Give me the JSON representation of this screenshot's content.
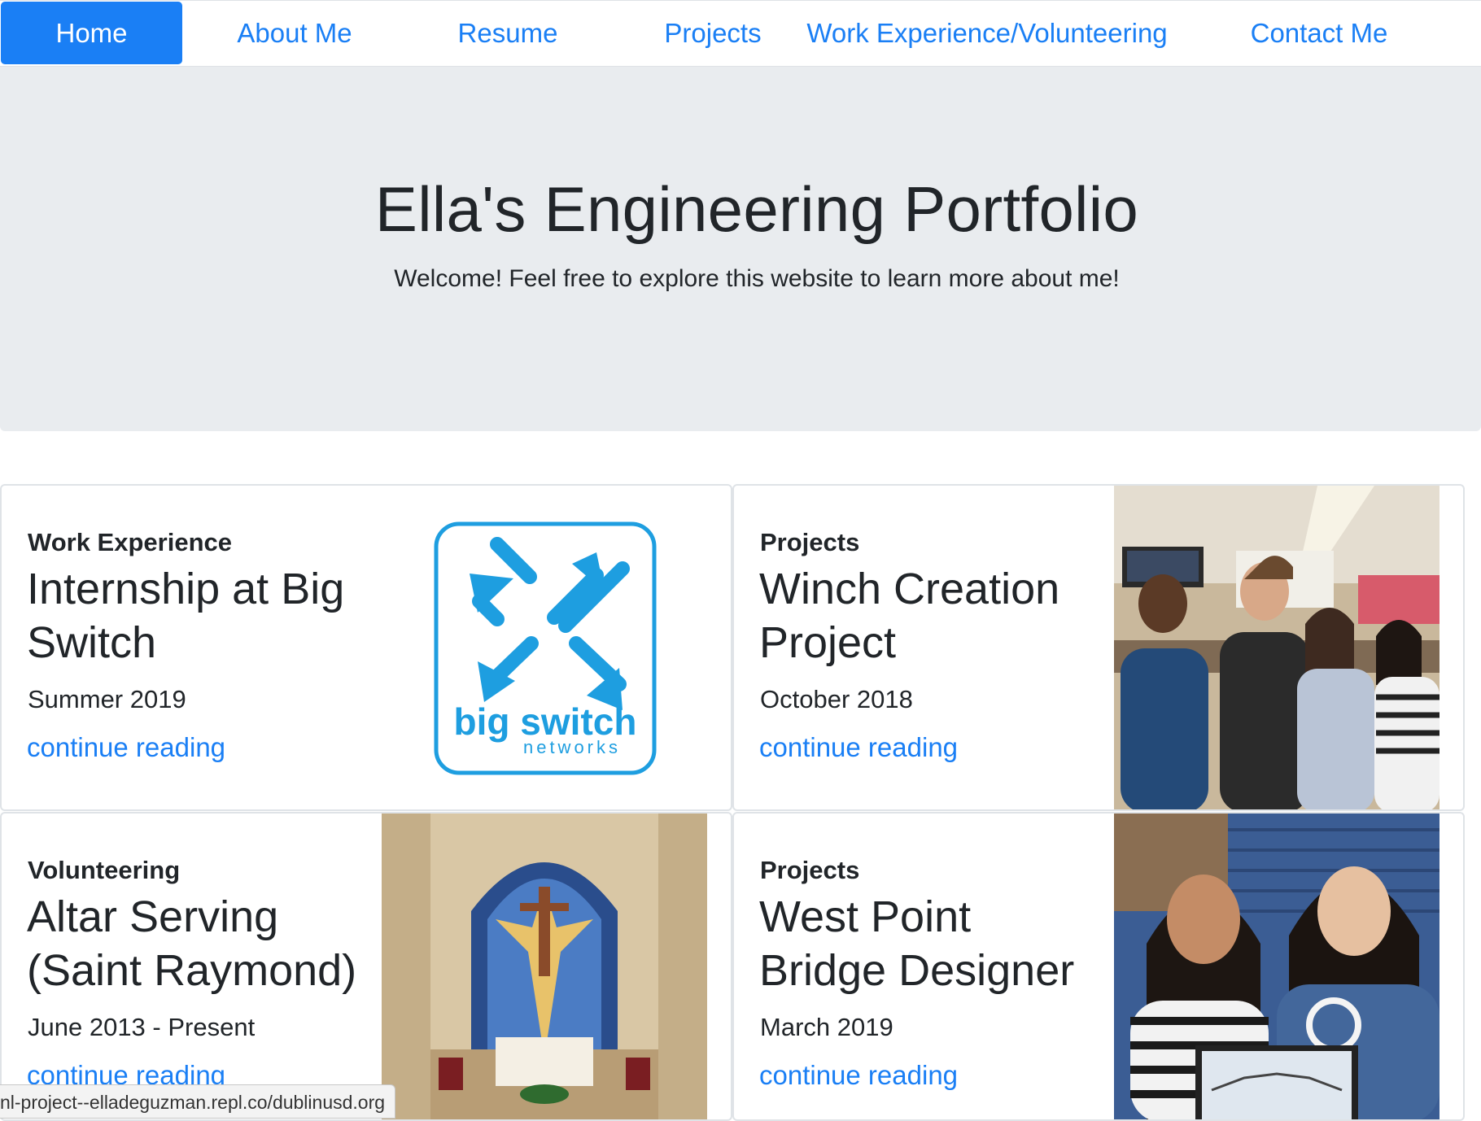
{
  "nav": {
    "home": "Home",
    "about": "About Me",
    "resume": "Resume",
    "projects": "Projects",
    "work": "Work Experience/Volunteering",
    "contact": "Contact Me"
  },
  "jumbotron": {
    "title": "Ella's Engineering Portfolio",
    "lead": "Welcome! Feel free to explore this website to learn more about me!"
  },
  "cards": [
    {
      "category": "Work Experience",
      "title_line1": "Internship at Big",
      "title_line2": "Switch",
      "date": "Summer 2019",
      "link": "continue reading",
      "logo_text": "big switch",
      "logo_sub": "networks"
    },
    {
      "category": "Projects",
      "title_line1": "Winch Creation",
      "title_line2": "Project",
      "date": "October 2018",
      "link": "continue reading"
    },
    {
      "category": "Volunteering",
      "title_line1": "Altar Serving",
      "title_line2": "(Saint Raymond)",
      "date": "June 2013 - Present",
      "link": "continue reading"
    },
    {
      "category": "Projects",
      "title_line1": "West Point",
      "title_line2": "Bridge Designer",
      "date": "March 2019",
      "link": "continue reading"
    }
  ],
  "status_url": "nl-project--elladeguzman.repl.co/dublinusd.org",
  "colors": {
    "primary": "#1a7ff5",
    "jumbotron_bg": "#e9ecef",
    "logo_blue": "#1e9ee0"
  }
}
